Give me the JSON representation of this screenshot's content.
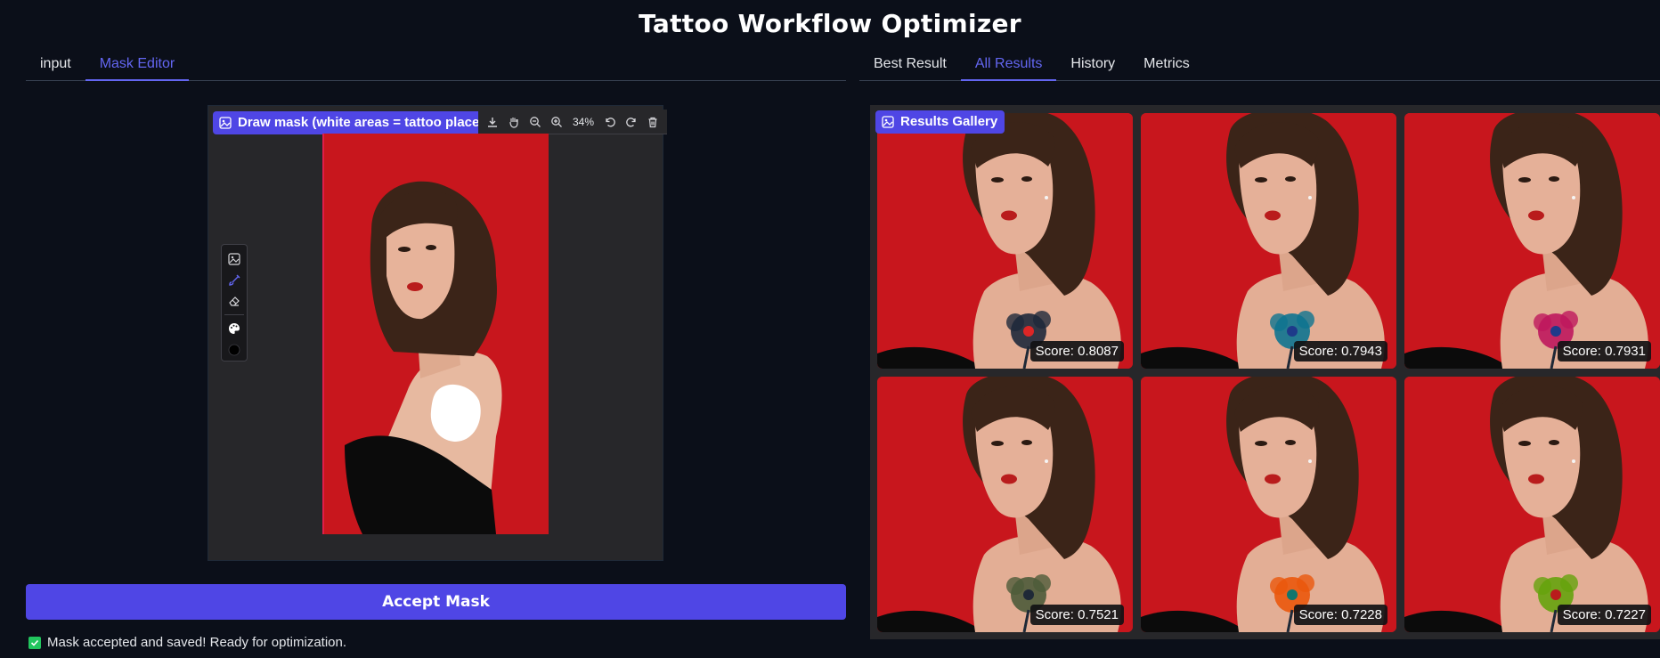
{
  "app": {
    "title": "Tattoo Workflow Optimizer"
  },
  "left_tabs": [
    {
      "label": "input",
      "active": false
    },
    {
      "label": "Mask Editor",
      "active": true
    }
  ],
  "right_tabs": [
    {
      "label": "Best Result",
      "active": false
    },
    {
      "label": "All Results",
      "active": true
    },
    {
      "label": "History",
      "active": false
    },
    {
      "label": "Metrics",
      "active": false
    }
  ],
  "mask_editor": {
    "label": "Draw mask (white areas = tattoo placement)",
    "label_icon": "image-icon",
    "zoom": "34%",
    "toolbar_icons": [
      "download-icon",
      "pan-hand-icon",
      "zoom-out-icon",
      "zoom-in-icon",
      "undo-icon",
      "redo-icon",
      "trash-icon"
    ],
    "side_tools": [
      "image-icon",
      "brush-icon",
      "eraser-icon",
      "palette-icon",
      "color-swatch-icon"
    ],
    "accept_button": "Accept Mask",
    "status_text": "Mask accepted and saved! Ready for optimization."
  },
  "gallery": {
    "label": "Results Gallery",
    "items": [
      {
        "score": "Score: 0.8087",
        "tattoo_color": "#1e293b",
        "accent": "#dc2626"
      },
      {
        "score": "Score: 0.7943",
        "tattoo_color": "#0e7490",
        "accent": "#1e3a8a"
      },
      {
        "score": "Score: 0.7931",
        "tattoo_color": "#be185d",
        "accent": "#1e3a8a"
      },
      {
        "score": "Score: 0.7521",
        "tattoo_color": "#4d5b3a",
        "accent": "#1f2937"
      },
      {
        "score": "Score: 0.7228",
        "tattoo_color": "#ea580c",
        "accent": "#0f766e"
      },
      {
        "score": "Score: 0.7227",
        "tattoo_color": "#65a30d",
        "accent": "#b91c1c"
      }
    ]
  },
  "colors": {
    "background": "#0b0f19",
    "accent": "#4f46e5",
    "panel": "#27272a",
    "portrait_bg": "#c8161d"
  }
}
